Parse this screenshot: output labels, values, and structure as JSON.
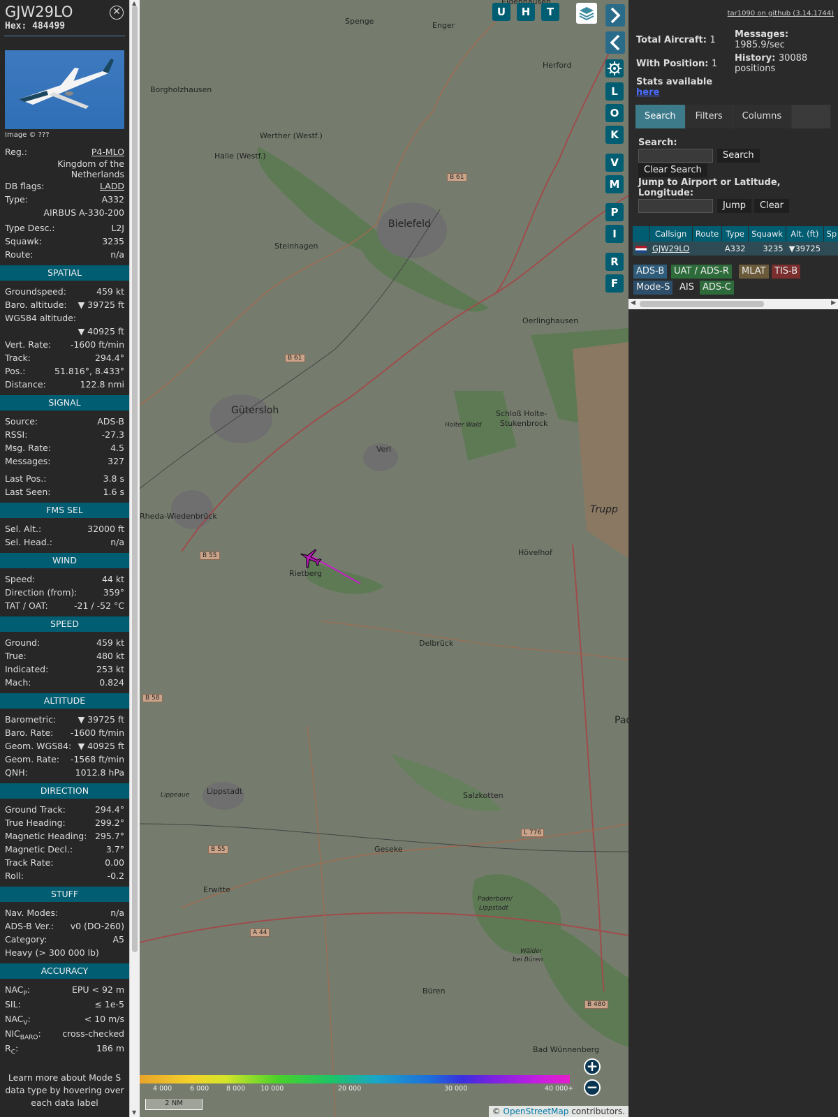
{
  "infoblock": {
    "callsign": "GJW29LO",
    "hex_label": "Hex:",
    "hex": "484499",
    "image_credit": "Image © ???",
    "reg_label": "Reg.:",
    "reg": "P4-MLO",
    "country": "Kingdom of the Netherlands",
    "dbflags_label": "DB flags:",
    "dbflags": "LADD",
    "type_label": "Type:",
    "type": "A332",
    "type_full": "AIRBUS A-330-200",
    "typedesc_label": "Type Desc.:",
    "typedesc": "L2J",
    "squawk_label": "Squawk:",
    "squawk": "3235",
    "route_label": "Route:",
    "route": "n/a",
    "spatial": {
      "title": "SPATIAL",
      "groundspeed_label": "Groundspeed:",
      "groundspeed": "459 kt",
      "baro_label": "Baro. altitude:",
      "baro": "▼ 39725 ft",
      "wgs_label": "WGS84 altitude:",
      "wgs": "▼ 40925 ft",
      "vrate_label": "Vert. Rate:",
      "vrate": "-1600 ft/min",
      "track_label": "Track:",
      "track": "294.4°",
      "pos_label": "Pos.:",
      "pos": "51.816°, 8.433°",
      "dist_label": "Distance:",
      "dist": "122.8 nmi"
    },
    "signal": {
      "title": "SIGNAL",
      "source_label": "Source:",
      "source": "ADS-B",
      "rssi_label": "RSSI:",
      "rssi": "-27.3",
      "msgrate_label": "Msg. Rate:",
      "msgrate": "4.5",
      "messages_label": "Messages:",
      "messages": "327",
      "lastpos_label": "Last Pos.:",
      "lastpos": "3.8 s",
      "lastseen_label": "Last Seen:",
      "lastseen": "1.6 s"
    },
    "fms": {
      "title": "FMS SEL",
      "selalt_label": "Sel. Alt.:",
      "selalt": "32000 ft",
      "selhead_label": "Sel. Head.:",
      "selhead": "n/a"
    },
    "wind": {
      "title": "WIND",
      "speed_label": "Speed:",
      "speed": "44 kt",
      "dir_label": "Direction (from):",
      "dir": "359°",
      "tat_label": "TAT / OAT:",
      "tat": "-21 / -52 °C"
    },
    "speed": {
      "title": "SPEED",
      "ground_label": "Ground:",
      "ground": "459 kt",
      "true_label": "True:",
      "true": "480 kt",
      "ind_label": "Indicated:",
      "ind": "253 kt",
      "mach_label": "Mach:",
      "mach": "0.824"
    },
    "altitude": {
      "title": "ALTITUDE",
      "baro_label": "Barometric:",
      "baro": "▼ 39725 ft",
      "barorate_label": "Baro. Rate:",
      "barorate": "-1600 ft/min",
      "geom_label": "Geom. WGS84:",
      "geom": "▼ 40925 ft",
      "geomrate_label": "Geom. Rate:",
      "geomrate": "-1568 ft/min",
      "qnh_label": "QNH:",
      "qnh": "1012.8 hPa"
    },
    "direction": {
      "title": "DIRECTION",
      "gt_label": "Ground Track:",
      "gt": "294.4°",
      "th_label": "True Heading:",
      "th": "299.2°",
      "mh_label": "Magnetic Heading:",
      "mh": "295.7°",
      "md_label": "Magnetic Decl.:",
      "md": "3.7°",
      "tr_label": "Track Rate:",
      "tr": "0.00",
      "roll_label": "Roll:",
      "roll": "-0.2"
    },
    "stuff": {
      "title": "STUFF",
      "nav_label": "Nav. Modes:",
      "nav": "n/a",
      "adsb_label": "ADS-B Ver.:",
      "adsb": "v0 (DO-260)",
      "cat_label": "Category:",
      "cat": "A5",
      "heavy": "Heavy (> 300 000 lb)"
    },
    "accuracy": {
      "title": "ACCURACY",
      "nacp_label": "NAC",
      "nacp_sub": "P",
      "nacp": "EPU < 92 m",
      "sil_label": "SIL:",
      "sil": "≤ 1e-5",
      "nacv_label": "NAC",
      "nacv_sub": "V",
      "nacv": "< 10 m/s",
      "nicbaro_label": "NIC",
      "nicbaro_sub": "BARO",
      "nicbaro": "cross-checked",
      "rc_label": "R",
      "rc_sub": "C",
      "rc": "186 m"
    },
    "footer": "Learn more about Mode S data type by hovering over each data label"
  },
  "map": {
    "buttons_top": [
      "U",
      "H",
      "T"
    ],
    "buttons_side": [
      "L",
      "O",
      "K",
      "V",
      "M",
      "P",
      "I",
      "R",
      "F"
    ],
    "places": [
      {
        "name": "Spenge"
      },
      {
        "name": "Enger"
      },
      {
        "name": "Herford"
      },
      {
        "name": "Borgholzhausen"
      },
      {
        "name": "Werther (Westf.)"
      },
      {
        "name": "Halle (Westf.)"
      },
      {
        "name": "Bielefeld"
      },
      {
        "name": "Steinhagen"
      },
      {
        "name": "Oerlinghausen"
      },
      {
        "name": "Gütersloh"
      },
      {
        "name": "Schloß Holte-"
      },
      {
        "name": "Stukenbrock"
      },
      {
        "name": "Holter Wald"
      },
      {
        "name": "Verl"
      },
      {
        "name": "Rheda-Wiedenbrück"
      },
      {
        "name": "Rietberg"
      },
      {
        "name": "Hövelhof"
      },
      {
        "name": "Delbrück"
      },
      {
        "name": "Lippstadt"
      },
      {
        "name": "Salzkotten"
      },
      {
        "name": "Geseke"
      },
      {
        "name": "Erwitte"
      },
      {
        "name": "Paderborn/"
      },
      {
        "name": "Lippstadt"
      },
      {
        "name": "Büren"
      },
      {
        "name": "Bad Wünnenberg"
      },
      {
        "name": "Trupp"
      },
      {
        "name": "Pad"
      },
      {
        "name": "Wälder"
      },
      {
        "name": "bei Büren"
      },
      {
        "name": "Lippeaue"
      },
      {
        "name": "Eidenhausen"
      }
    ],
    "roads": [
      "B 61",
      "B 61",
      "B 55",
      "B 58",
      "B 55",
      "A 44",
      "L 776",
      "B 480"
    ],
    "legend_ticks": [
      "4 000",
      "6 000",
      "8 000",
      "10 000",
      "20 000",
      "30 000",
      "40 000+"
    ],
    "scale": "2 NM",
    "osm_credit_prefix": "©",
    "osm_credit_link": "OpenStreetMap",
    "osm_credit_suffix": "contributors."
  },
  "panel": {
    "github": "tar1090 on github (3.14.1744)",
    "total_label": "Total Aircraft:",
    "total": "1",
    "withpos_label": "With Position:",
    "withpos": "1",
    "messages_label": "Messages:",
    "messages": "1985.9/sec",
    "history_label": "History:",
    "history": "30088 positions",
    "stats_label": "Stats available",
    "stats_link": "here",
    "tabs": [
      "Search",
      "Filters",
      "Columns"
    ],
    "search_label": "Search:",
    "search_button": "Search",
    "clear_search": "Clear Search",
    "jump_label": "Jump to Airport or Latitude, Longitude:",
    "jump_button": "Jump",
    "clear_button": "Clear",
    "table": {
      "headers": [
        "",
        "Callsign",
        "Route",
        "Type",
        "Squawk",
        "Alt. (ft)",
        "Sp"
      ],
      "row": {
        "callsign": "GJW29LO",
        "route": "",
        "type": "A332",
        "squawk": "3235",
        "alt": "▼39725"
      }
    },
    "sources": [
      "ADS-B",
      "UAT / ADS-R",
      "MLAT",
      "TIS-B",
      "Mode-S",
      "AIS",
      "ADS-C"
    ],
    "colors": {
      "accent": "#005d72",
      "adsb": "#2e5c7a",
      "uat": "#2e6b3a",
      "mlat": "#6b5a3a",
      "tisb": "#7a2e2e",
      "modes": "#2e4f6b",
      "adsc": "#2e6b3a"
    }
  }
}
